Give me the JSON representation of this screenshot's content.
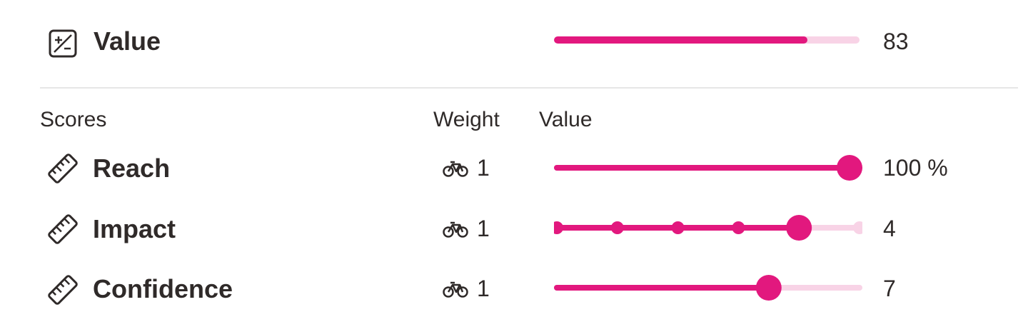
{
  "summary": {
    "label": "Value",
    "value_text": "83",
    "value": 83,
    "max": 100,
    "icon": "plus-minus-square-icon"
  },
  "headers": {
    "scores": "Scores",
    "weight": "Weight",
    "value": "Value"
  },
  "scores": [
    {
      "label": "Reach",
      "weight": "1",
      "value": 100,
      "min": 0,
      "max": 100,
      "value_text": "100 %",
      "discrete_steps": 0,
      "icon": "ruler-icon",
      "weight_icon": "bicycle-icon"
    },
    {
      "label": "Impact",
      "weight": "1",
      "value": 4,
      "min": 0,
      "max": 5,
      "value_text": "4",
      "discrete_steps": 5,
      "icon": "ruler-icon",
      "weight_icon": "bicycle-icon"
    },
    {
      "label": "Confidence",
      "weight": "1",
      "value": 7,
      "min": 0,
      "max": 10,
      "value_text": "7",
      "discrete_steps": 0,
      "icon": "ruler-icon",
      "weight_icon": "bicycle-icon"
    }
  ],
  "colors": {
    "accent": "#e2187e",
    "track": "#f8d3e6",
    "text": "#2f2a29",
    "divider": "#e6e6e6"
  }
}
